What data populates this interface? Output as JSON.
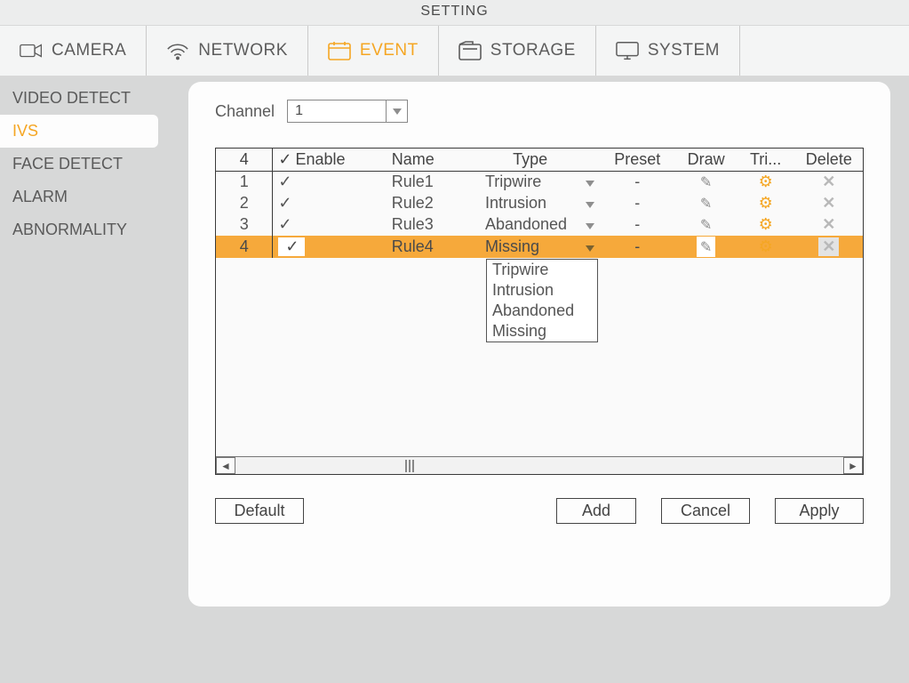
{
  "title": "SETTING",
  "top_tabs": {
    "camera": "CAMERA",
    "network": "NETWORK",
    "event": "EVENT",
    "storage": "STORAGE",
    "system": "SYSTEM"
  },
  "sidebar": {
    "items": [
      {
        "label": "VIDEO DETECT"
      },
      {
        "label": "IVS"
      },
      {
        "label": "FACE DETECT"
      },
      {
        "label": "ALARM"
      },
      {
        "label": "ABNORMALITY"
      }
    ]
  },
  "channel": {
    "label": "Channel",
    "value": "1"
  },
  "table": {
    "count_header": "4",
    "headers": {
      "enable": "Enable",
      "name": "Name",
      "type": "Type",
      "preset": "Preset",
      "draw": "Draw",
      "trigger": "Tri...",
      "del": "Delete"
    },
    "rows": [
      {
        "idx": "1",
        "enabled": "✓",
        "name": "Rule1",
        "type": "Tripwire",
        "preset": "-"
      },
      {
        "idx": "2",
        "enabled": "✓",
        "name": "Rule2",
        "type": "Intrusion",
        "preset": "-"
      },
      {
        "idx": "3",
        "enabled": "✓",
        "name": "Rule3",
        "type": "Abandoned",
        "preset": "-"
      },
      {
        "idx": "4",
        "enabled": "✓",
        "name": "Rule4",
        "type": "Missing",
        "preset": "-"
      }
    ]
  },
  "type_options": [
    "Tripwire",
    "Intrusion",
    "Abandoned",
    "Missing"
  ],
  "buttons": {
    "default": "Default",
    "add": "Add",
    "cancel": "Cancel",
    "apply": "Apply"
  }
}
